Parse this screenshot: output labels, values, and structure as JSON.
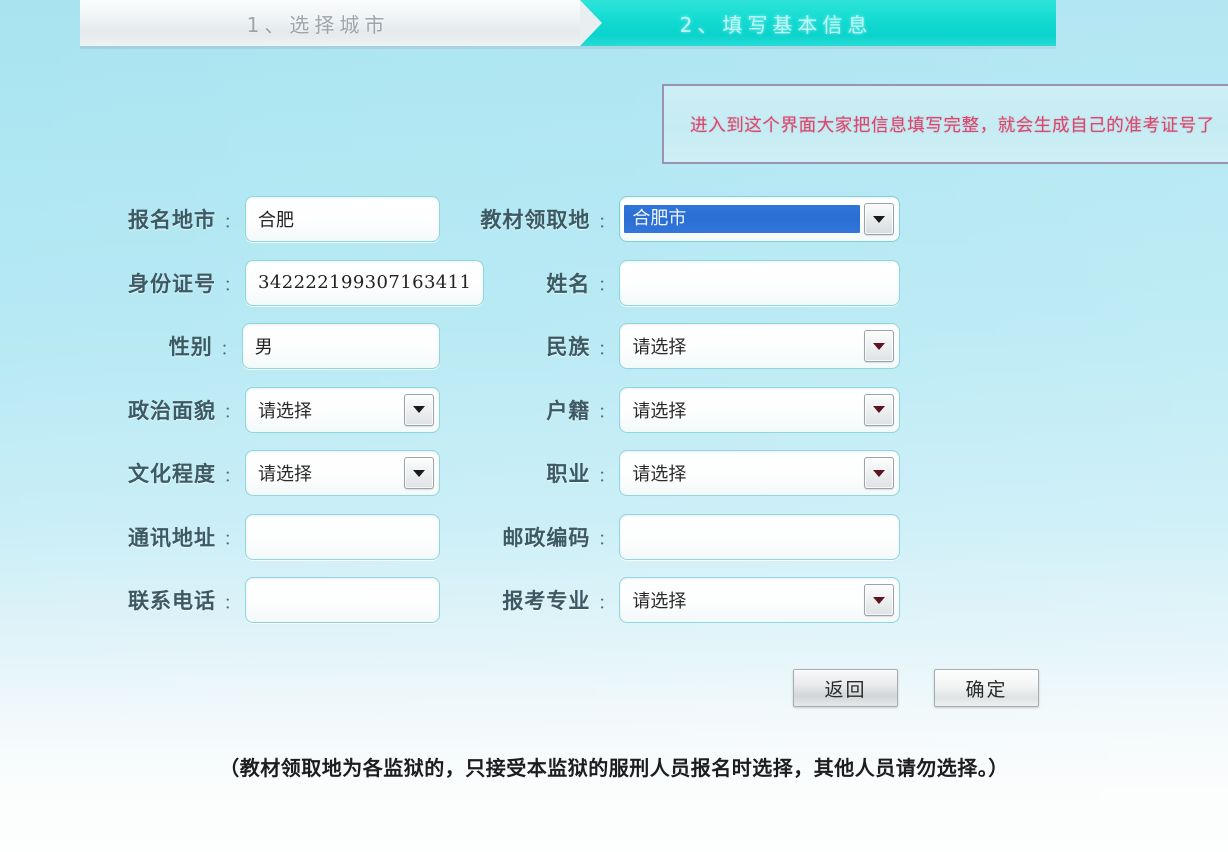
{
  "steps": [
    {
      "label": "1、选择城市",
      "state": "completed"
    },
    {
      "label": "2、填写基本信息",
      "state": "active"
    }
  ],
  "notice": {
    "text": "进入到这个界面大家把信息填写完整，就会生成自己的准考证号了",
    "color": "#d8496f",
    "border_color": "#9a92b4"
  },
  "form": {
    "colon": "：",
    "rows": [
      {
        "left": {
          "label": "报名地市",
          "type": "text",
          "value": "合肥",
          "placeholder": ""
        },
        "right": {
          "label": "教材领取地",
          "type": "select",
          "value": "合肥市",
          "focused": true
        }
      },
      {
        "left": {
          "label": "身份证号",
          "type": "text",
          "value": "342222199307163411",
          "placeholder": "",
          "numeric": true
        },
        "right": {
          "label": "姓名",
          "type": "text",
          "value": "",
          "placeholder": ""
        }
      },
      {
        "left": {
          "label": "性别",
          "type": "text",
          "value": "男",
          "placeholder": ""
        },
        "right": {
          "label": "民族",
          "type": "select",
          "value": "请选择",
          "arrow": "warm"
        }
      },
      {
        "left": {
          "label": "政治面貌",
          "type": "select",
          "value": "请选择"
        },
        "right": {
          "label": "户籍",
          "type": "select",
          "value": "请选择",
          "arrow": "warm"
        }
      },
      {
        "left": {
          "label": "文化程度",
          "type": "select",
          "value": "请选择"
        },
        "right": {
          "label": "职业",
          "type": "select",
          "value": "请选择",
          "arrow": "warm"
        }
      },
      {
        "left": {
          "label": "通讯地址",
          "type": "text",
          "value": "",
          "placeholder": ""
        },
        "right": {
          "label": "邮政编码",
          "type": "text",
          "value": "",
          "placeholder": ""
        }
      },
      {
        "left": {
          "label": "联系电话",
          "type": "text",
          "value": "",
          "placeholder": ""
        },
        "right": {
          "label": "报考专业",
          "type": "select",
          "value": "请选择",
          "arrow": "warm"
        }
      }
    ]
  },
  "buttons": {
    "back": "返回",
    "confirm": "确定"
  },
  "footnote": "（教材领取地为各监狱的，只接受本监狱的服刑人员报名时选择，其他人员请勿选择。）"
}
